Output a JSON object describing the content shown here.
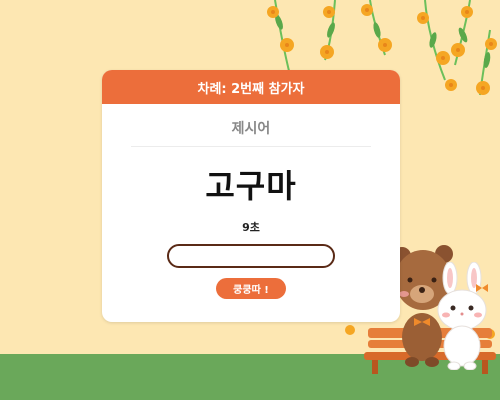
{
  "card": {
    "header": "차례: 2번째 참가자",
    "subtitle": "제시어",
    "word": "고구마",
    "timer": "9초",
    "input_value": "",
    "input_placeholder": "",
    "submit_label": "쿵쿵따 !"
  },
  "colors": {
    "background": "#fde7b2",
    "accent": "#ec6e3b",
    "ground": "#6aa85a",
    "input_border": "#5a2a16"
  },
  "decor": {
    "icons": [
      "flower-branch-icon",
      "bench-icon",
      "bear-icon",
      "rabbit-icon"
    ]
  }
}
